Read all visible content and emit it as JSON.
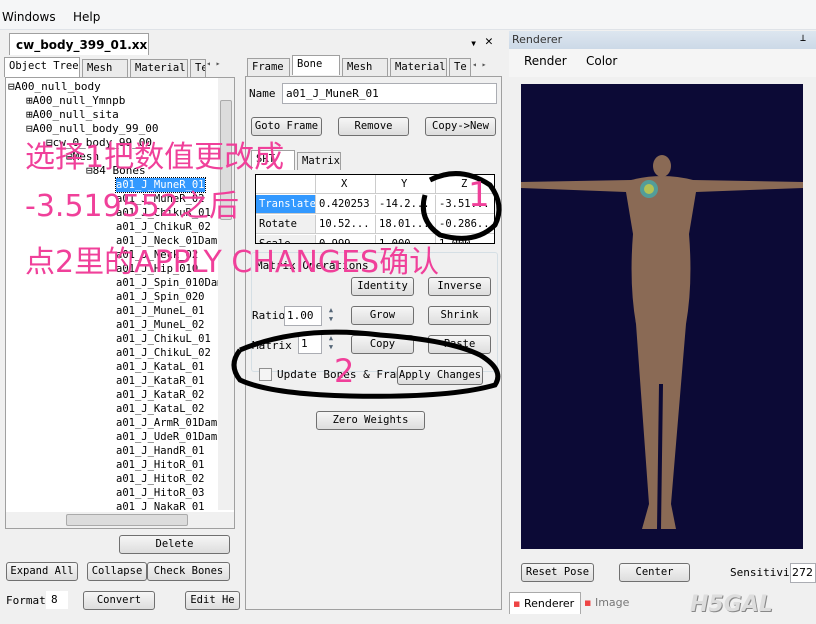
{
  "menu": {
    "windows": "Windows",
    "help": "Help"
  },
  "document_tab": "cw_body_399_01.xx",
  "left_tabs": [
    "Object Tree",
    "Mesh",
    "Material",
    "Te"
  ],
  "tree": {
    "root": "A00_null_body",
    "children": [
      "A00_null_Ymnpb",
      "A00_null_sita",
      "A00_null_body_99_00"
    ],
    "sub": "cw_0_body_99_00",
    "mesh": "Mesh",
    "bones": "84 Bones",
    "bones_list": [
      "a01_J_MuneR_01",
      "a01_J_MuneR_02",
      "a01_J_ChikuR_01",
      "a01_J_ChikuR_02",
      "a01_J_Neck_01Dam",
      "a01_J_Neck_02",
      "a01_J_Hip_010",
      "a01_J_Spin_010Dam",
      "a01_J_Spin_020",
      "a01_J_MuneL_01",
      "a01_J_MuneL_02",
      "a01_J_ChikuL_01",
      "a01_J_ChikuL_02",
      "a01_J_KataL_01",
      "a01_J_KataR_01",
      "a01_J_KataR_02",
      "a01_J_KataL_02",
      "a01_J_ArmR_01Dam",
      "a01_J_UdeR_01Dam",
      "a01_J_HandR_01",
      "a01_J_HitoR_01",
      "a01_J_HitoR_02",
      "a01_J_HitoR_03",
      "a01_J_NakaR_01"
    ],
    "selected": "a01_J_MuneR_01"
  },
  "left_buttons": {
    "delete": "Delete",
    "expand_all": "Expand All",
    "collapse": "Collapse",
    "check_bones": "Check Bones",
    "format_label": "Format",
    "format_value": "8",
    "convert": "Convert",
    "edit_header": "Edit He"
  },
  "mid_tabs": [
    "Frame",
    "Bone",
    "Mesh",
    "Material",
    "Te"
  ],
  "bone": {
    "name_label": "Name",
    "name_value": "a01_J_MuneR_01",
    "goto_frame": "Goto Frame",
    "remove": "Remove",
    "copy_new": "Copy->New",
    "subtabs": [
      "SRT",
      "Matrix"
    ],
    "columns": [
      "",
      "X",
      "Y",
      "Z"
    ],
    "rows": [
      [
        "Translate",
        "0.420253",
        "-14.2...",
        "-3.51..."
      ],
      [
        "Rotate",
        "10.52...",
        "18.01...",
        "-0.286..."
      ],
      [
        "Scale",
        "0.999",
        "1.000",
        "1.000"
      ]
    ],
    "matrix_ops": "Matrix Operations",
    "identity": "Identity",
    "inverse": "Inverse",
    "ratio_label": "Ratio",
    "ratio_value": "1.00",
    "grow": "Grow",
    "shrink": "Shrink",
    "matrix_label": "Matrix #",
    "matrix_value": "1",
    "copy": "Copy",
    "paste": "Paste",
    "update_label": "Update Bones & Frame",
    "update_checked": false,
    "apply": "Apply Changes",
    "zero_weights": "Zero Weights"
  },
  "renderer": {
    "title": "Renderer",
    "menu": [
      "Render",
      "Color"
    ],
    "reset_pose": "Reset Pose",
    "center": "Center",
    "sensitivity_label": "Sensitivit",
    "sensitivity_value": "272",
    "bottom_tabs": [
      "Renderer",
      "Image"
    ],
    "bg_color": "#0c0a36"
  },
  "annotation": {
    "line1": "选择1把数值更改成",
    "line2": "-3.519552之后",
    "line3": "点2里的APPLY CHANGES确认",
    "mark1": "1",
    "mark2": "2",
    "color": "#f0409a"
  },
  "watermark": "H5GAL"
}
